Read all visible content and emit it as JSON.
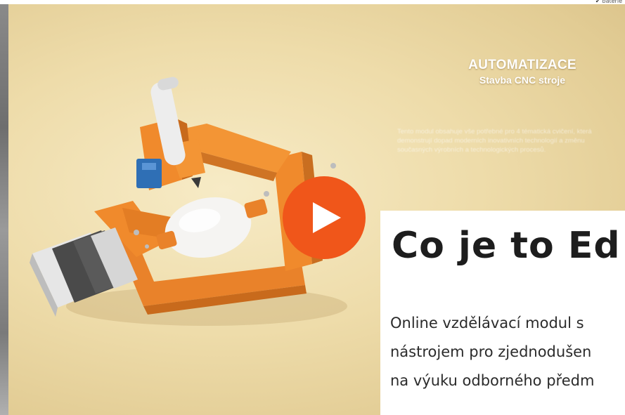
{
  "corner": {
    "label": "baterie"
  },
  "video": {
    "heading": "AUTOMATIZACE",
    "subheading": "Stavba CNC stroje",
    "description": "Tento modul obsahuje vše potřebné pro 4 tématická cvičení, která demonstrují dopad moderních inovativních technologií a změnu současných výrobních a technologických procesů.",
    "play_icon": "play-icon",
    "colors": {
      "background": "#eedcaa",
      "machine_orange": "#f08a2c",
      "play_button": "#f0561a",
      "motor_gray": "#4a4a4a",
      "servo_blue": "#2f6fb5"
    }
  },
  "card": {
    "title": "Co je to Ed",
    "lines": [
      "Online vzdělávací modul s",
      "nástrojem pro zjednodušen",
      "na výuku odborného předm"
    ]
  }
}
